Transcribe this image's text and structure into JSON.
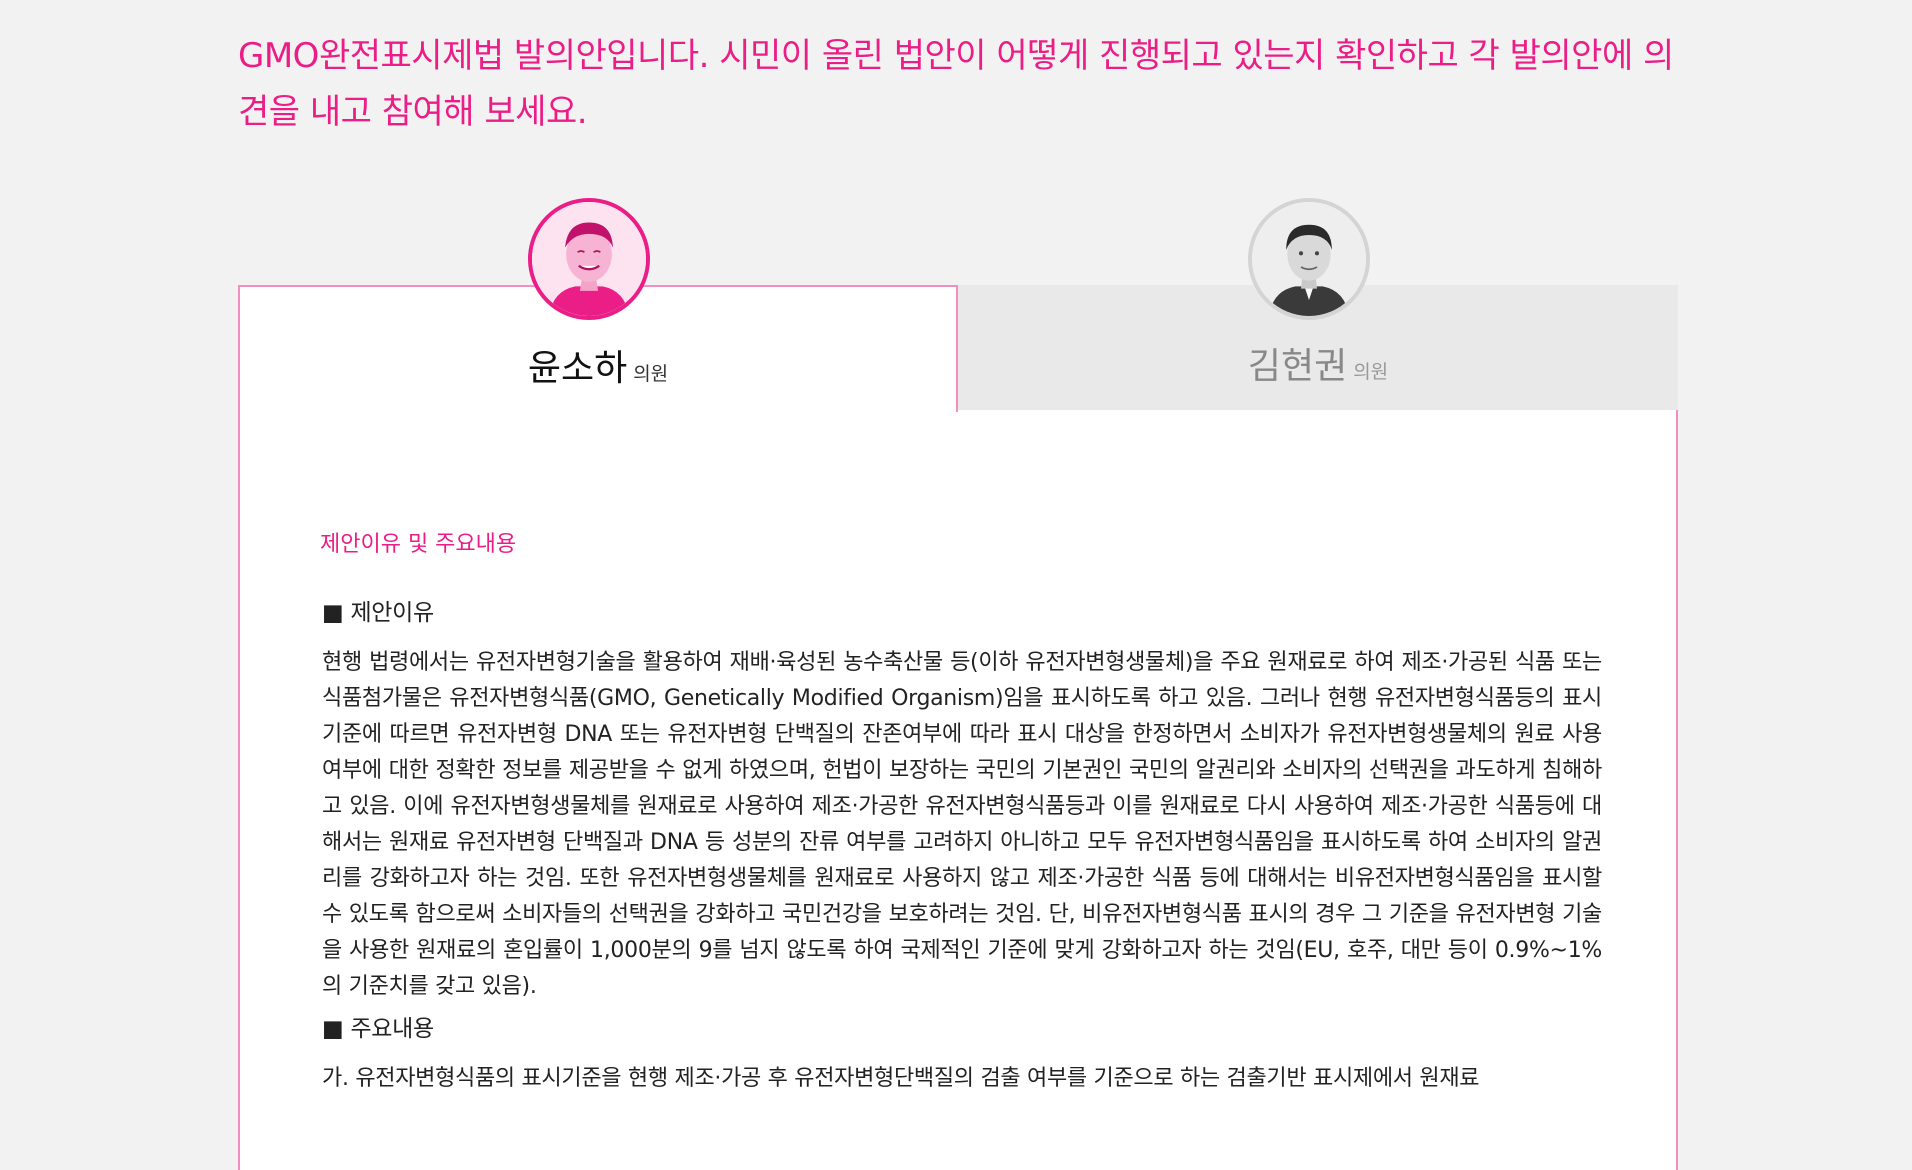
{
  "intro": {
    "text": "GMO완전표시제법 발의안입니다. 시민이 올린 법안이 어떻게 진행되고 있는지 확인하고 각 발의안에 의견을 내고 참여해 보세요."
  },
  "tabs": [
    {
      "name": "윤소하",
      "title": "의원",
      "active": true
    },
    {
      "name": "김현권",
      "title": "의원",
      "active": false
    }
  ],
  "section": {
    "title": "제안이유 및 주요내용",
    "reason_heading": "■ 제안이유",
    "reason_text": "현행 법령에서는 유전자변형기술을 활용하여 재배·육성된 농수축산물 등(이하 유전자변형생물체)을 주요 원재료로 하여 제조·가공된 식품 또는 식품첨가물은 유전자변형식품(GMO, Genetically Modified Organism)임을 표시하도록 하고 있음. 그러나 현행 유전자변형식품등의 표시기준에 따르면 유전자변형 DNA 또는 유전자변형 단백질의 잔존여부에 따라 표시 대상을 한정하면서 소비자가 유전자변형생물체의 원료 사용 여부에 대한 정확한 정보를 제공받을 수 없게 하였으며, 헌법이 보장하는 국민의 기본권인 국민의 알권리와 소비자의 선택권을 과도하게 침해하고 있음. 이에 유전자변형생물체를 원재료로 사용하여 제조·가공한 유전자변형식품등과 이를 원재료로 다시 사용하여 제조·가공한 식품등에 대해서는 원재료 유전자변형 단백질과 DNA 등 성분의 잔류 여부를 고려하지 아니하고 모두 유전자변형식품임을 표시하도록 하여 소비자의 알권리를 강화하고자 하는 것임. 또한 유전자변형생물체를 원재료로 사용하지 않고 제조·가공한 식품 등에 대해서는 비유전자변형식품임을 표시할 수 있도록 함으로써 소비자들의 선택권을 강화하고 국민건강을 보호하려는 것임. 단, 비유전자변형식품 표시의 경우 그 기준을 유전자변형 기술을 사용한 원재료의 혼입률이 1,000분의 9를 넘지 않도록 하여 국제적인 기준에 맞게 강화하고자 하는 것임(EU, 호주, 대만 등이 0.9%~1%의 기준치를 갖고 있음).",
    "main_heading": "■ 주요내용",
    "main_text": "가. 유전자변형식품의 표시기준을 현행 제조·가공 후 유전자변형단백질의 검출 여부를 기준으로 하는 검출기반 표시제에서 원재료"
  },
  "colors": {
    "accent": "#ea1e86",
    "tab_border": "#f28fc0",
    "background": "#f2f2f2",
    "inactive_tab": "#e9e9e9"
  }
}
